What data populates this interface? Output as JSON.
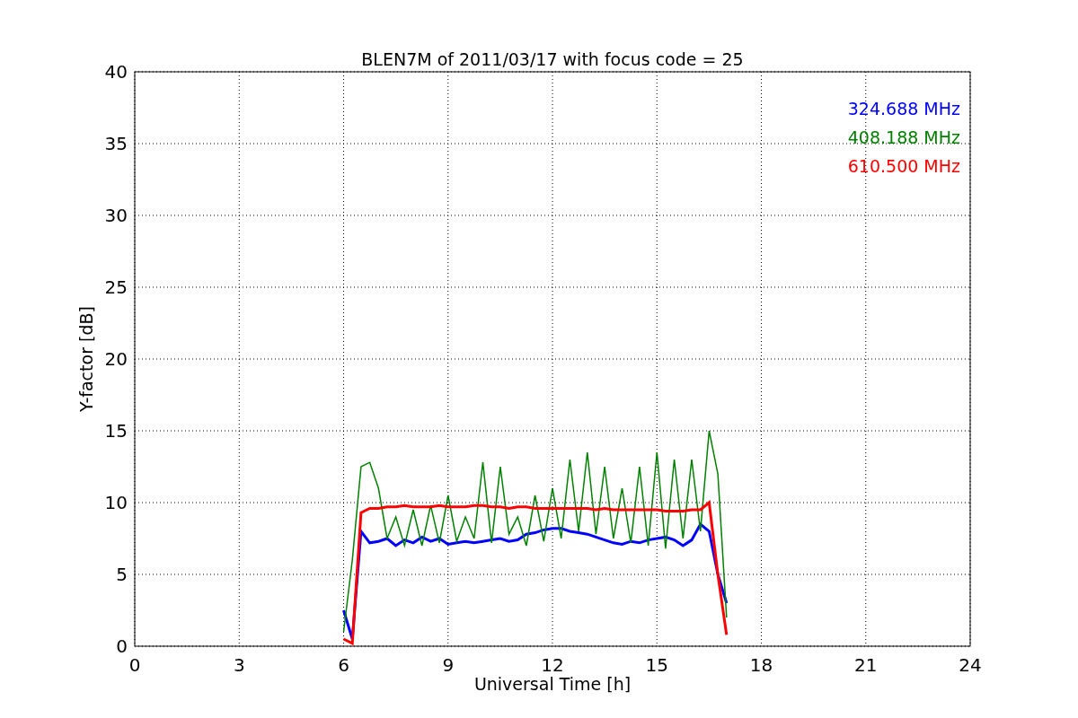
{
  "chart_data": {
    "type": "line",
    "title": "BLEN7M of 2011/03/17 with focus code = 25",
    "xlabel": "Universal Time [h]",
    "ylabel": "Y-factor [dB]",
    "xlim": [
      0,
      24
    ],
    "ylim": [
      0,
      40
    ],
    "xticks": [
      0,
      3,
      6,
      9,
      12,
      15,
      18,
      21,
      24
    ],
    "yticks": [
      0,
      5,
      10,
      15,
      20,
      25,
      30,
      35,
      40
    ],
    "grid": true,
    "x": [
      6,
      6.25,
      6.5,
      6.75,
      7,
      7.25,
      7.5,
      7.75,
      8,
      8.25,
      8.5,
      8.75,
      9,
      9.25,
      9.5,
      9.75,
      10,
      10.25,
      10.5,
      10.75,
      11,
      11.25,
      11.5,
      11.75,
      12,
      12.25,
      12.5,
      12.75,
      13,
      13.25,
      13.5,
      13.75,
      14,
      14.25,
      14.5,
      14.75,
      15,
      15.25,
      15.5,
      15.75,
      16,
      16.25,
      16.5,
      16.75,
      17
    ],
    "series": [
      {
        "name": "324.688 MHz",
        "color": "#0000ff",
        "values": [
          2.5,
          0.5,
          8,
          7.2,
          7.3,
          7.5,
          7,
          7.4,
          7.2,
          7.6,
          7.3,
          7.5,
          7.1,
          7.2,
          7.3,
          7.2,
          7.3,
          7.4,
          7.5,
          7.3,
          7.4,
          7.8,
          7.9,
          8.1,
          8.2,
          8.2,
          8,
          7.9,
          7.8,
          7.6,
          7.4,
          7.2,
          7.1,
          7.3,
          7.2,
          7.4,
          7.5,
          7.6,
          7.4,
          7,
          7.4,
          8.5,
          8,
          5,
          3
        ]
      },
      {
        "name": "408.188 MHz",
        "color": "#008000",
        "values": [
          1,
          6,
          12.5,
          12.8,
          11,
          7.5,
          9,
          7,
          9.5,
          7,
          9.8,
          7.2,
          10.5,
          7.3,
          9,
          7.5,
          12.8,
          7.2,
          12.5,
          7.8,
          9,
          7,
          10.5,
          7.3,
          11,
          7.5,
          13,
          8,
          13.5,
          7.8,
          12.5,
          7.5,
          11,
          7.2,
          12.5,
          7,
          13.5,
          6.8,
          13,
          7.5,
          13,
          8,
          15,
          12,
          2
        ]
      },
      {
        "name": "610.500 MHz",
        "color": "#ff0000",
        "values": [
          0.5,
          0.2,
          9.3,
          9.6,
          9.6,
          9.7,
          9.7,
          9.8,
          9.7,
          9.7,
          9.7,
          9.8,
          9.7,
          9.7,
          9.7,
          9.8,
          9.8,
          9.7,
          9.7,
          9.6,
          9.7,
          9.7,
          9.6,
          9.6,
          9.6,
          9.6,
          9.6,
          9.6,
          9.6,
          9.5,
          9.6,
          9.5,
          9.5,
          9.5,
          9.5,
          9.5,
          9.5,
          9.4,
          9.4,
          9.4,
          9.5,
          9.5,
          10,
          5,
          0.8
        ]
      }
    ]
  }
}
